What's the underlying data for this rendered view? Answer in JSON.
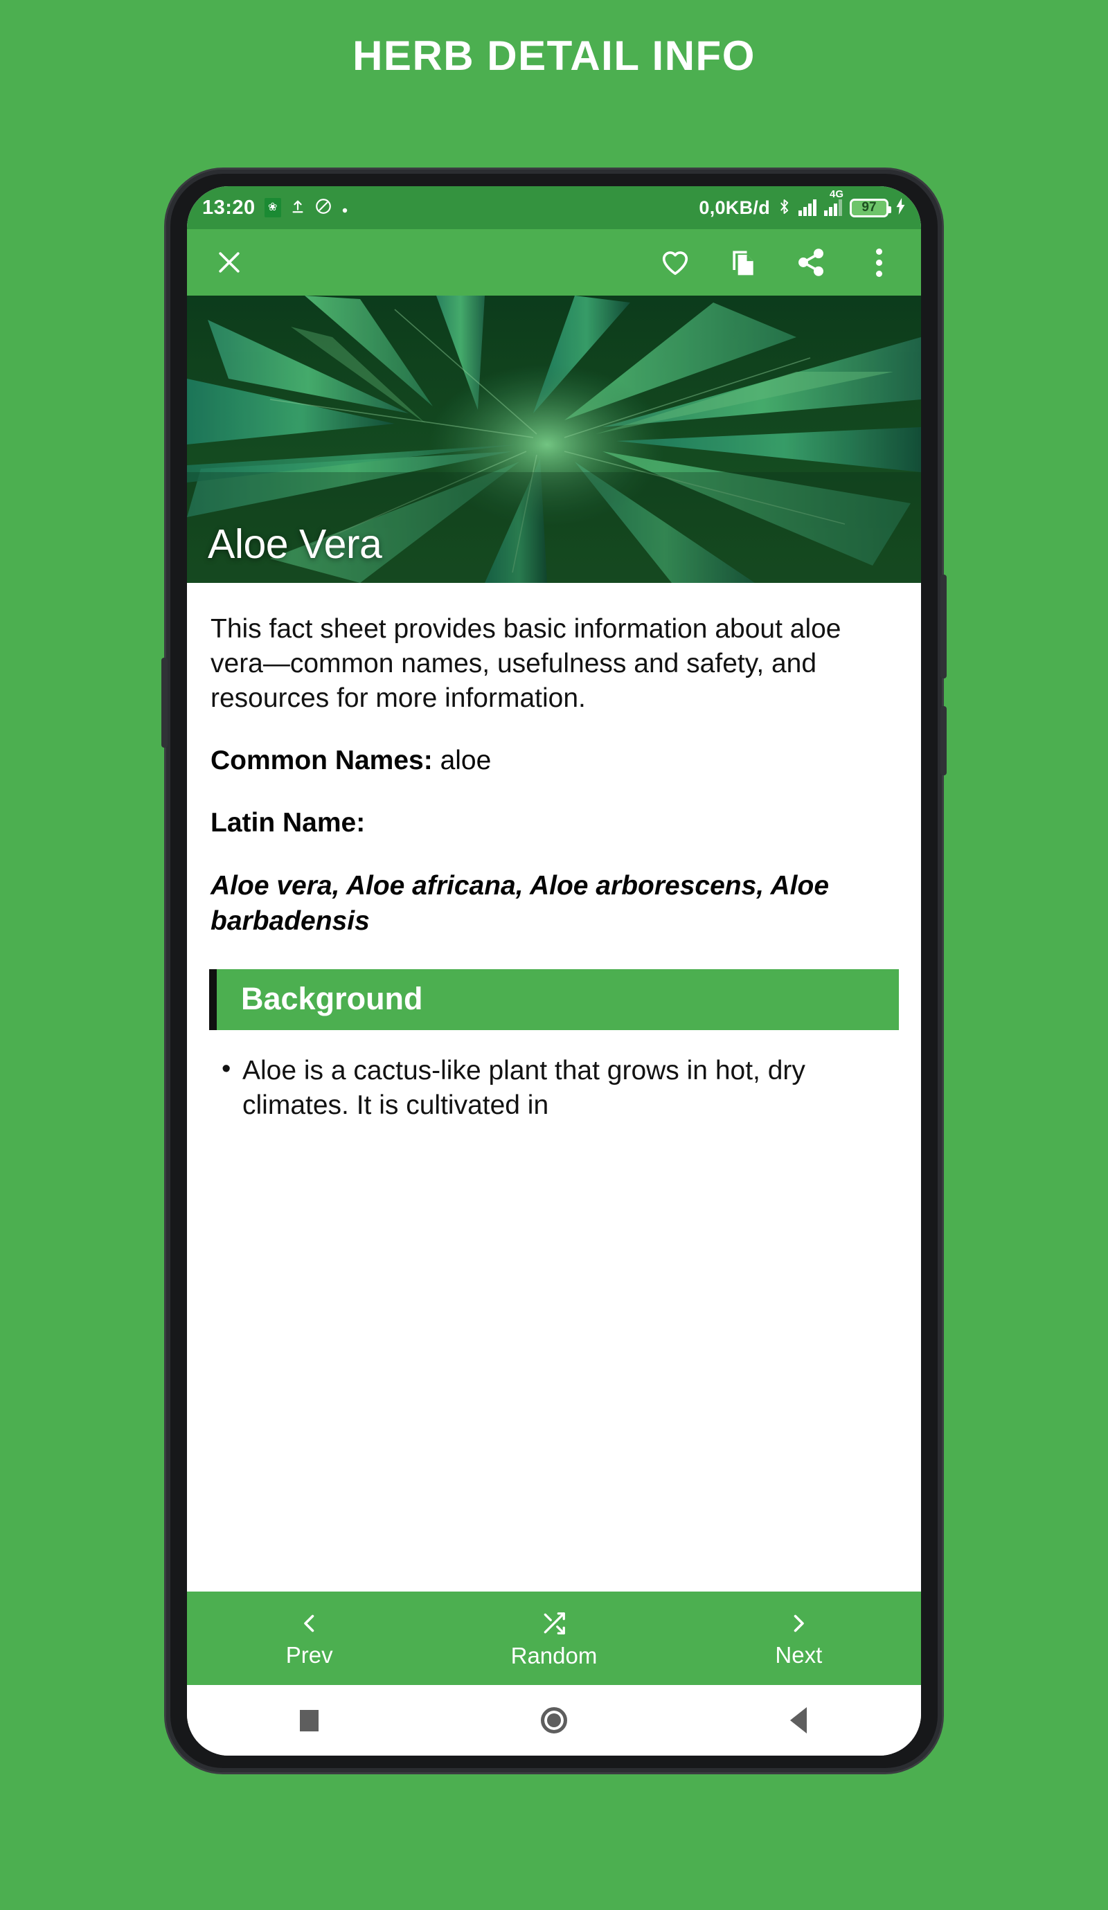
{
  "page": {
    "title": "HERB DETAIL INFO",
    "accent_green": "#4CAF50",
    "statusbar_green": "#34933f"
  },
  "statusbar": {
    "time": "13:20",
    "app_badge": "HERB",
    "data_rate": "0,0KB/d",
    "network_type": "4G",
    "battery_percent": "97",
    "icons": [
      "app-badge-icon",
      "upload-icon",
      "do-not-disturb-icon",
      "dot-icon",
      "bluetooth-icon",
      "signal-bars-icon",
      "signal-bars-4g-icon",
      "battery-icon",
      "charging-bolt-icon"
    ]
  },
  "toolbar": {
    "close_icon": "close-icon",
    "favorite_icon": "heart-icon",
    "copy_icon": "copy-icon",
    "share_icon": "share-icon",
    "overflow_icon": "more-vertical-icon"
  },
  "hero": {
    "plant_name": "Aloe Vera",
    "image_alt": "aloe-vera-plant-photo"
  },
  "content": {
    "intro": "This fact sheet provides basic information about aloe vera—common names, usefulness and safety, and resources for more information.",
    "common_names_label": "Common Names:",
    "common_names_value": "aloe",
    "latin_name_label": "Latin Name:",
    "latin_names": "Aloe vera, Aloe africana, Aloe arborescens, Aloe barbadensis",
    "section_heading": "Background",
    "bullets": [
      "Aloe is a cactus-like plant that grows in hot, dry climates. It is cultivated in"
    ]
  },
  "appnav": {
    "items": [
      {
        "label": "Prev",
        "icon": "chevron-left-icon"
      },
      {
        "label": "Random",
        "icon": "shuffle-icon"
      },
      {
        "label": "Next",
        "icon": "chevron-right-icon"
      }
    ]
  },
  "sysnav": {
    "items": [
      {
        "name": "recents-button",
        "icon": "square-icon"
      },
      {
        "name": "home-button",
        "icon": "circle-icon"
      },
      {
        "name": "back-button",
        "icon": "triangle-back-icon"
      }
    ]
  }
}
